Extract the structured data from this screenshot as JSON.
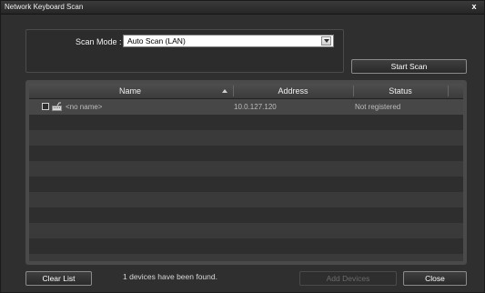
{
  "window": {
    "title": "Network Keyboard Scan",
    "close_glyph": "x"
  },
  "scan": {
    "mode_label": "Scan Mode :",
    "mode_value": "Auto Scan (LAN)",
    "start_label": "Start Scan"
  },
  "table": {
    "columns": [
      "Name",
      "Address",
      "Status"
    ],
    "rows": [
      {
        "checked": false,
        "name": "<no name>",
        "address": "10.0.127.120",
        "status": "Not registered",
        "icon": "keyboard-icon"
      }
    ]
  },
  "footer": {
    "clear_label": "Clear List",
    "message": "1 devices have been found.",
    "add_label": "Add Devices",
    "close_label": "Close"
  },
  "icons": {
    "dropdown": "chevron-down-icon",
    "sort": "sort-ascending-icon"
  }
}
